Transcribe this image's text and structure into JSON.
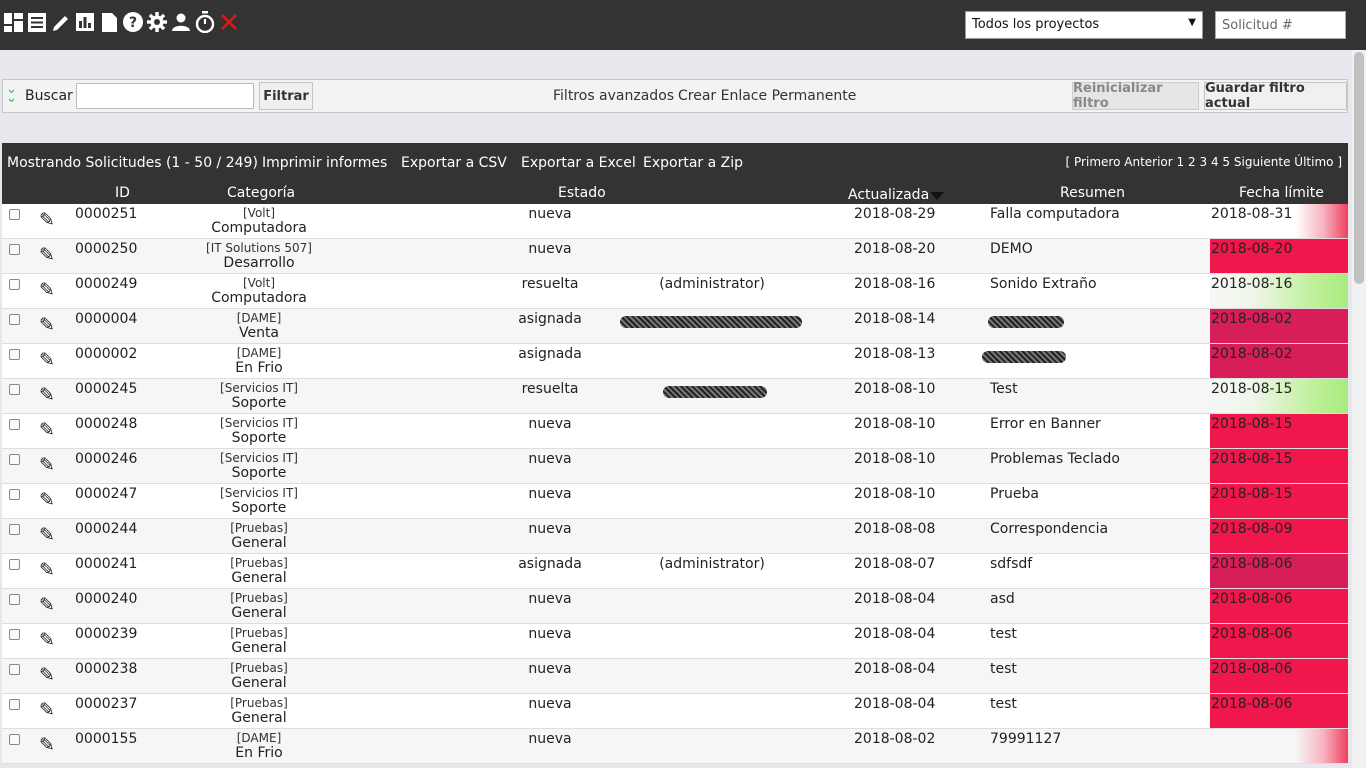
{
  "toolbar": {
    "icons": [
      "dashboard-icon",
      "list-icon",
      "pencil-icon",
      "chart-icon",
      "document-icon",
      "help-icon",
      "gear-icon",
      "user-icon",
      "stopwatch-icon",
      "close-icon"
    ],
    "project_select": "Todos los proyectos",
    "ticket_placeholder": "Solicitud #"
  },
  "filter": {
    "buscar_label": "Buscar",
    "search_value": "",
    "filtrar_label": "Filtrar",
    "advanced_link": "Filtros avanzados",
    "permalink_link": "Crear Enlace Permanente",
    "reset_label": "Reinicializar filtro",
    "save_label": "Guardar filtro actual"
  },
  "results": {
    "showing": "Mostrando Solicitudes (1 - 50 / 249)",
    "print": "Imprimir informes",
    "csv": "Exportar a CSV",
    "excel": "Exportar a Excel",
    "zip": "Exportar a Zip",
    "pager": {
      "open": "[",
      "first": "Primero",
      "prev": "Anterior",
      "pages": [
        "1",
        "2",
        "3",
        "4",
        "5"
      ],
      "next": "Siguiente",
      "last": "Último",
      "close": "]"
    }
  },
  "columns": {
    "id": "ID",
    "category": "Categoría",
    "status": "Estado",
    "updated": "Actualizada",
    "summary": "Resumen",
    "due": "Fecha límite"
  },
  "colors": {
    "topbar": "#333333",
    "due_overdue": "#f0174c",
    "due_ok": "#a8ec7f",
    "filter_chevron": "#2dbb55"
  },
  "rows": [
    {
      "id": "0000251",
      "project": "[Volt]",
      "category": "Computadora",
      "status": "nueva",
      "assignee": "",
      "updated": "2018-08-29",
      "summary": "Falla computadora",
      "due": "2018-08-31",
      "due_style": "fade"
    },
    {
      "id": "0000250",
      "project": "[IT Solutions 507]",
      "category": "Desarrollo",
      "status": "nueva",
      "assignee": "",
      "updated": "2018-08-20",
      "summary": "DEMO",
      "due": "2018-08-20",
      "due_style": "red"
    },
    {
      "id": "0000249",
      "project": "[Volt]",
      "category": "Computadora",
      "status": "resuelta",
      "assignee": "(administrator)",
      "updated": "2018-08-16",
      "summary": "Sonido Extraño",
      "due": "2018-08-16",
      "due_style": "green"
    },
    {
      "id": "0000004",
      "project": "[DAME]",
      "category": "Venta",
      "status": "asignada",
      "assignee": "",
      "updated": "2018-08-14",
      "summary": "",
      "due": "2018-08-02",
      "due_style": "deep"
    },
    {
      "id": "0000002",
      "project": "[DAME]",
      "category": "En Frio",
      "status": "asignada",
      "assignee": "",
      "updated": "2018-08-13",
      "summary": "",
      "due": "2018-08-02",
      "due_style": "deep"
    },
    {
      "id": "0000245",
      "project": "[Servicios IT]",
      "category": "Soporte",
      "status": "resuelta",
      "assignee": "",
      "updated": "2018-08-10",
      "summary": "Test",
      "due": "2018-08-15",
      "due_style": "green"
    },
    {
      "id": "0000248",
      "project": "[Servicios IT]",
      "category": "Soporte",
      "status": "nueva",
      "assignee": "",
      "updated": "2018-08-10",
      "summary": "Error en Banner",
      "due": "2018-08-15",
      "due_style": "red"
    },
    {
      "id": "0000246",
      "project": "[Servicios IT]",
      "category": "Soporte",
      "status": "nueva",
      "assignee": "",
      "updated": "2018-08-10",
      "summary": "Problemas Teclado",
      "due": "2018-08-15",
      "due_style": "red"
    },
    {
      "id": "0000247",
      "project": "[Servicios IT]",
      "category": "Soporte",
      "status": "nueva",
      "assignee": "",
      "updated": "2018-08-10",
      "summary": "Prueba",
      "due": "2018-08-15",
      "due_style": "red"
    },
    {
      "id": "0000244",
      "project": "[Pruebas]",
      "category": "General",
      "status": "nueva",
      "assignee": "",
      "updated": "2018-08-08",
      "summary": "Correspondencia",
      "due": "2018-08-09",
      "due_style": "red"
    },
    {
      "id": "0000241",
      "project": "[Pruebas]",
      "category": "General",
      "status": "asignada",
      "assignee": "(administrator)",
      "updated": "2018-08-07",
      "summary": "sdfsdf",
      "due": "2018-08-06",
      "due_style": "deep"
    },
    {
      "id": "0000240",
      "project": "[Pruebas]",
      "category": "General",
      "status": "nueva",
      "assignee": "",
      "updated": "2018-08-04",
      "summary": "asd",
      "due": "2018-08-06",
      "due_style": "red"
    },
    {
      "id": "0000239",
      "project": "[Pruebas]",
      "category": "General",
      "status": "nueva",
      "assignee": "",
      "updated": "2018-08-04",
      "summary": "test",
      "due": "2018-08-06",
      "due_style": "red"
    },
    {
      "id": "0000238",
      "project": "[Pruebas]",
      "category": "General",
      "status": "nueva",
      "assignee": "",
      "updated": "2018-08-04",
      "summary": "test",
      "due": "2018-08-06",
      "due_style": "red"
    },
    {
      "id": "0000237",
      "project": "[Pruebas]",
      "category": "General",
      "status": "nueva",
      "assignee": "",
      "updated": "2018-08-04",
      "summary": "test",
      "due": "2018-08-06",
      "due_style": "red"
    },
    {
      "id": "0000155",
      "project": "[DAME]",
      "category": "En Frio",
      "status": "nueva",
      "assignee": "",
      "updated": "2018-08-02",
      "summary": "79991127",
      "due": "",
      "due_style": "fade"
    }
  ]
}
